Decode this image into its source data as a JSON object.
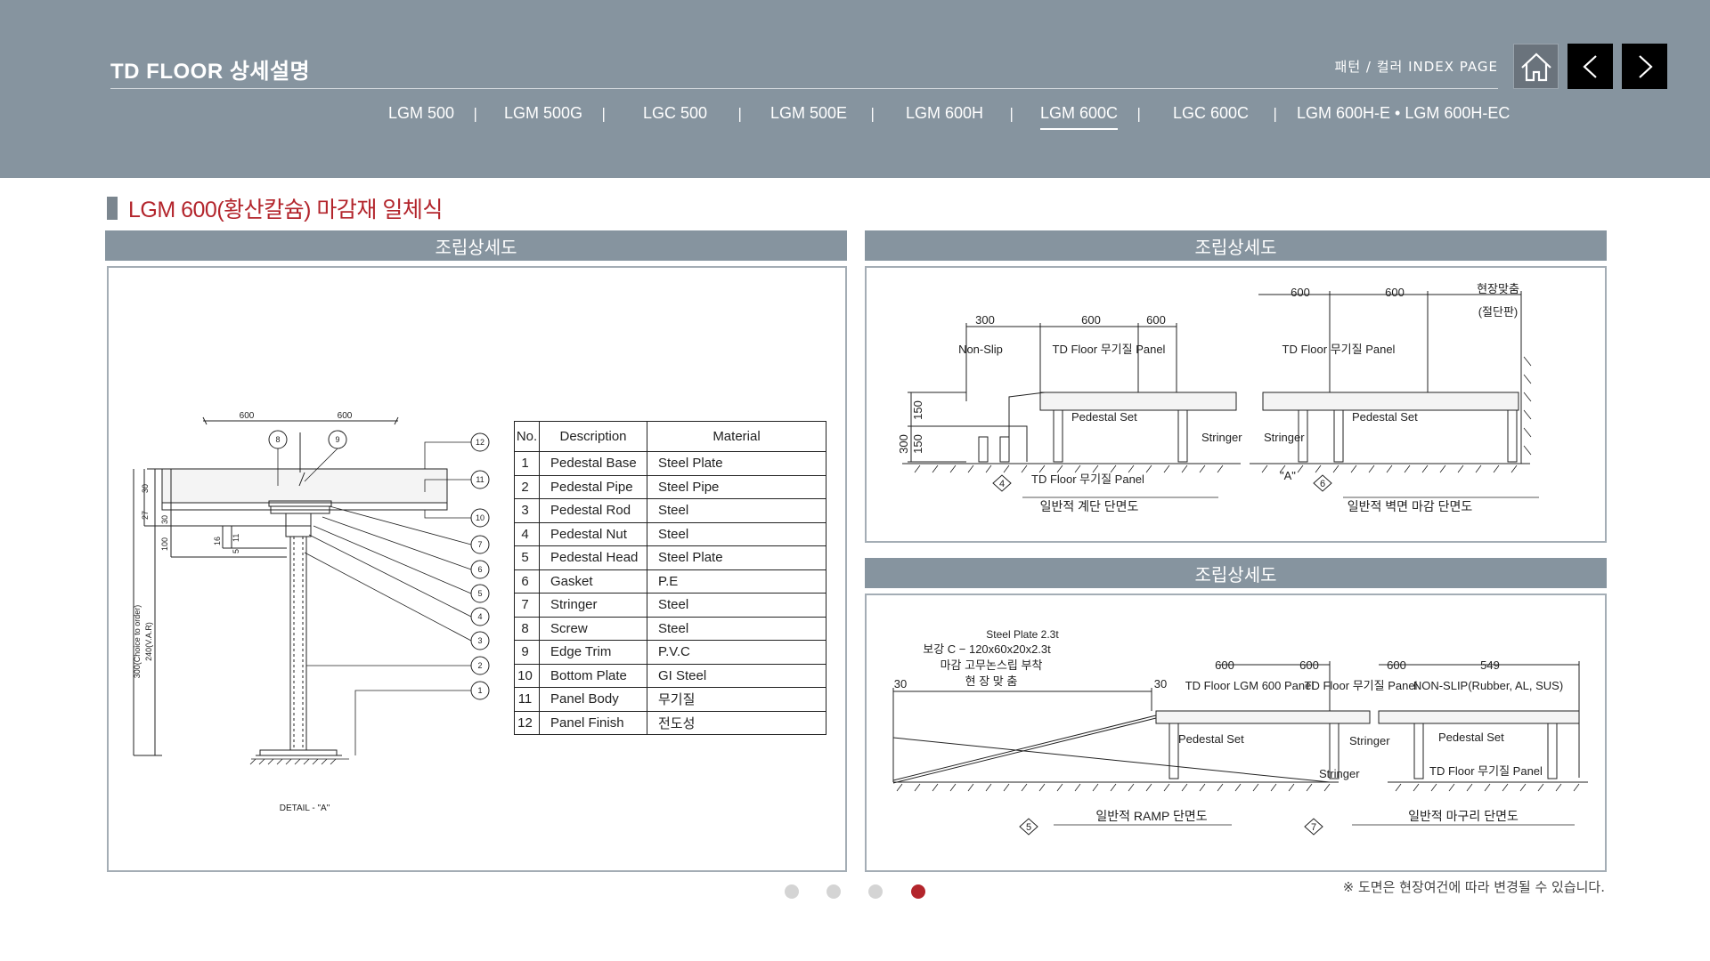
{
  "header": {
    "brand": "TD FLOOR 상세설명",
    "index_link": "패턴 / 컬러 INDEX PAGE",
    "tabs": [
      "LGM 500",
      "LGM 500G",
      "LGC 500",
      "LGM 500E",
      "LGM 600H",
      "LGM 600C",
      "LGC 600C",
      "LGM 600H-E • LGM 600H-EC"
    ],
    "active_tab": "LGM 600C",
    "separator": "|"
  },
  "section": {
    "title": "LGM 600(황산칼슘) 마감재 일체식"
  },
  "panels": {
    "left_title": "조립상세도",
    "top_right_title": "조립상세도",
    "bottom_right_title": "조립상세도"
  },
  "detail_a": {
    "dim_left": "600",
    "dim_right": "600",
    "caption": "DETAIL - \"A\"",
    "v_dims": [
      "30",
      "27",
      "30",
      "16",
      "11",
      "5",
      "100"
    ],
    "v_label_1": "300(Choice to order)",
    "v_label_2": "240(V.A.R)",
    "callouts": [
      "8",
      "9",
      "12",
      "11",
      "10",
      "7",
      "6",
      "5",
      "4",
      "3",
      "2",
      "1"
    ]
  },
  "parts_table": {
    "headers": [
      "No.",
      "Description",
      "Material"
    ],
    "rows": [
      [
        "1",
        "Pedestal Base",
        "Steel Plate"
      ],
      [
        "2",
        "Pedestal Pipe",
        "Steel Pipe"
      ],
      [
        "3",
        "Pedestal Rod",
        "Steel"
      ],
      [
        "4",
        "Pedestal Nut",
        "Steel"
      ],
      [
        "5",
        "Pedestal Head",
        "Steel Plate"
      ],
      [
        "6",
        "Gasket",
        "P.E"
      ],
      [
        "7",
        "Stringer",
        "Steel"
      ],
      [
        "8",
        "Screw",
        "Steel"
      ],
      [
        "9",
        "Edge Trim",
        "P.V.C"
      ],
      [
        "10",
        "Bottom Plate",
        "GI Steel"
      ],
      [
        "11",
        "Panel Body",
        "무기질"
      ],
      [
        "12",
        "Panel Finish",
        "전도성"
      ]
    ]
  },
  "stair_section": {
    "dims_top": [
      "300",
      "600",
      "600"
    ],
    "dims_left": [
      "300",
      "150",
      "150"
    ],
    "label_nonslip": "Non-Slip",
    "label_panel": "TD Floor 무기질 Panel",
    "label_pedestal": "Pedestal Set",
    "label_stringer": "Stringer",
    "label_panel_bottom": "TD Floor 무기질 Panel",
    "num": "4",
    "caption": "일반적 계단 단면도"
  },
  "wall_section": {
    "dims_top": [
      "600",
      "600"
    ],
    "label_field": "현장맞춤",
    "label_field_2": "(절단판)",
    "label_panel": "TD Floor 무기질 Panel",
    "label_stringer": "Stringer",
    "label_pedestal": "Pedestal Set",
    "label_a": "\"A\"",
    "num": "6",
    "caption": "일반적 벽면 마감 단면도"
  },
  "ramp_section": {
    "note_1": "Steel Plate 2.3t",
    "note_2": "보강 C − 120x60x20x2.3t",
    "note_3": "마감 고무논스립 부착",
    "note_4": "현 장 맞 춤",
    "dim_30_left": "30",
    "dim_30_mid": "30",
    "dims_top": [
      "600",
      "600"
    ],
    "label_panel": "TD Floor LGM 600 Panel",
    "label_pedestal": "Pedestal Set",
    "label_stringer": "Stringer",
    "num": "5",
    "caption": "일반적 RAMP 단면도"
  },
  "edge_section": {
    "dims_top": [
      "600",
      "549"
    ],
    "label_panel": "TD Floor 무기질 Panel",
    "label_nonslip": "NON-SLIP(Rubber, AL, SUS)",
    "label_stringer": "Stringer",
    "label_pedestal": "Pedestal Set",
    "label_panel_bottom": "TD Floor 무기질 Panel",
    "num": "7",
    "caption": "일반적 마구리 단면도"
  },
  "pagination": {
    "count": 4,
    "active": 4
  },
  "footnote": "※ 도면은 현장여건에 따라 변경될 수 있습니다.",
  "colors": {
    "header_bg": "#86949f",
    "accent_red": "#b3252c",
    "panel_bar": "#86949f"
  },
  "icons": {
    "home": "home-icon",
    "prev": "chevron-left-icon",
    "next": "chevron-right-icon"
  }
}
